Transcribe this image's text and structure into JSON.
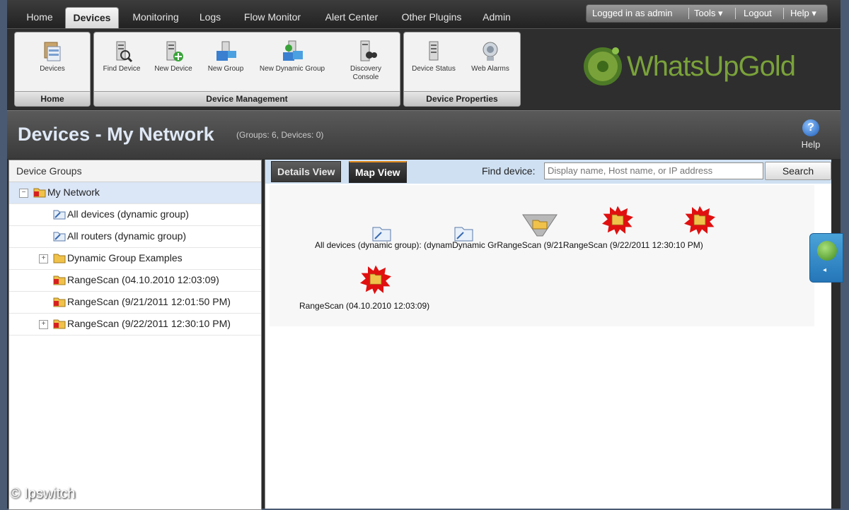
{
  "nav": {
    "tabs": [
      "Home",
      "Devices",
      "Monitoring",
      "Logs",
      "Flow Monitor",
      "Alert Center",
      "Other Plugins",
      "Admin"
    ],
    "active_tab": "Devices",
    "user": "Logged in as admin",
    "tools": "Tools",
    "logout": "Logout",
    "help": "Help"
  },
  "ribbon": {
    "groups": [
      {
        "label": "Home",
        "buttons": [
          "Devices"
        ]
      },
      {
        "label": "Device Management",
        "buttons": [
          "Find Device",
          "New Device",
          "New Group",
          "New Dynamic Group",
          "Discovery Console"
        ]
      },
      {
        "label": "Device Properties",
        "buttons": [
          "Device Status",
          "Web Alarms"
        ]
      }
    ]
  },
  "logo": "WhatsUpGold",
  "page": {
    "title": "Devices - My Network",
    "subtitle": "(Groups: 6, Devices: 0)",
    "help_label": "Help"
  },
  "left_panel": {
    "header": "Device Groups",
    "tree": [
      {
        "label": "My Network",
        "expander": "−",
        "icon": "folder-red-icon"
      },
      {
        "label": "All devices (dynamic group)",
        "icon": "dynamic-group-icon"
      },
      {
        "label": "All routers (dynamic group)",
        "icon": "dynamic-group-icon"
      },
      {
        "label": "Dynamic Group Examples",
        "expander": "+",
        "icon": "folder-icon"
      },
      {
        "label": "RangeScan (04.10.2010 12:03:09)",
        "icon": "folder-red-icon"
      },
      {
        "label": "RangeScan (9/21/2011 12:01:50 PM)",
        "icon": "folder-red-icon"
      },
      {
        "label": "RangeScan (9/22/2011 12:30:10 PM)",
        "expander": "+",
        "icon": "folder-red-icon"
      }
    ]
  },
  "right_panel": {
    "tabs": [
      "Details View",
      "Map View"
    ],
    "active_tab": "Map View",
    "find_label": "Find device:",
    "find_placeholder": "Display name, Host name, or IP address",
    "search_button": "Search",
    "map_labels": {
      "row1": "All devices (dynamic group): (dynamDynamic GrRangeScan (9/21RangeScan (9/22/2011 12:30:10 PM)",
      "row2": "RangeScan (04.10.2010 12:03:09)"
    }
  },
  "colors": {
    "accent_orange": "#e08a1c",
    "alert_red": "#e01010",
    "logo_green": "#7aa23a",
    "selection_blue": "#dbe6f7"
  },
  "watermark": "© Ipswitch"
}
